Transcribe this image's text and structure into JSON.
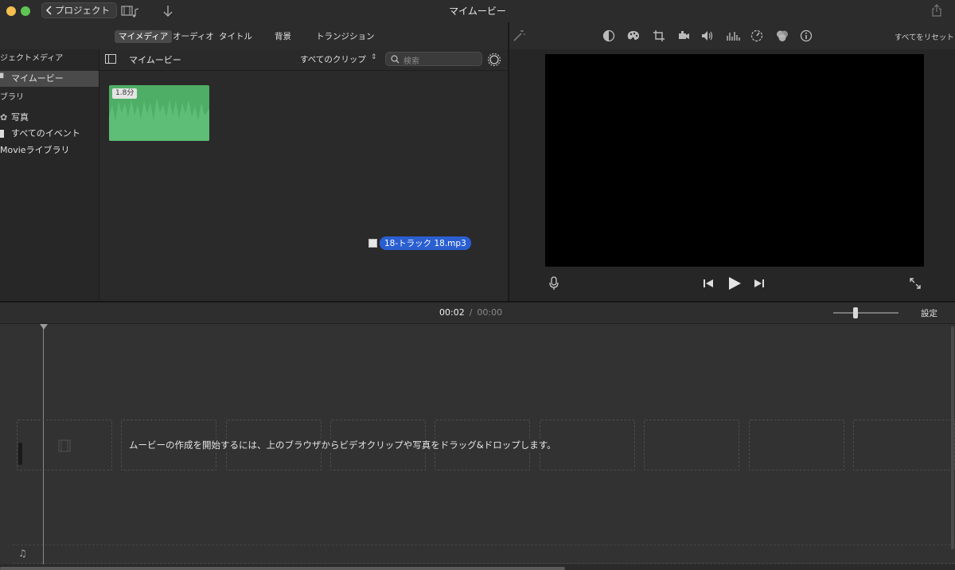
{
  "titlebar": {
    "back_label": "プロジェクト",
    "app_title": "マイムービー"
  },
  "toolbar": {
    "tabs": [
      {
        "label": "マイメディア",
        "active": true
      },
      {
        "label": "オーディオ"
      },
      {
        "label": "タイトル"
      },
      {
        "label": "背景"
      },
      {
        "label": "トランジション"
      }
    ]
  },
  "adjustments": {
    "reset_all": "すべてをリセット",
    "icons": [
      "magic-wand-icon",
      "color-balance-icon",
      "color-correction-icon",
      "crop-icon",
      "stabilization-icon",
      "volume-icon",
      "equalizer-icon",
      "speed-icon",
      "filter-icon",
      "info-icon"
    ]
  },
  "sidebar": {
    "section_projects": "ジェクトメディア",
    "project_item": "マイムービー",
    "section_libraries": "ブラリ",
    "photos": "写真",
    "all_events": "すべてのイベント",
    "imovie_library": "Movieライブラリ"
  },
  "browser": {
    "title": "マイムービー",
    "filter": "すべてのクリップ",
    "search_placeholder": "検索",
    "clip_duration": "1.8分",
    "dragged_file": "18-トラック 18.mp3"
  },
  "timeline": {
    "current_time": "00:02",
    "separator": "/",
    "total_time": "00:00",
    "settings": "設定",
    "empty_message": "ムービーの作成を開始するには、上のブラウザからビデオクリップや写真をドラッグ&ドロップします。"
  },
  "colors": {
    "accent_blue": "#2a5fd1",
    "clip_green": "#4fae66",
    "viewer_bg": "#000000"
  }
}
